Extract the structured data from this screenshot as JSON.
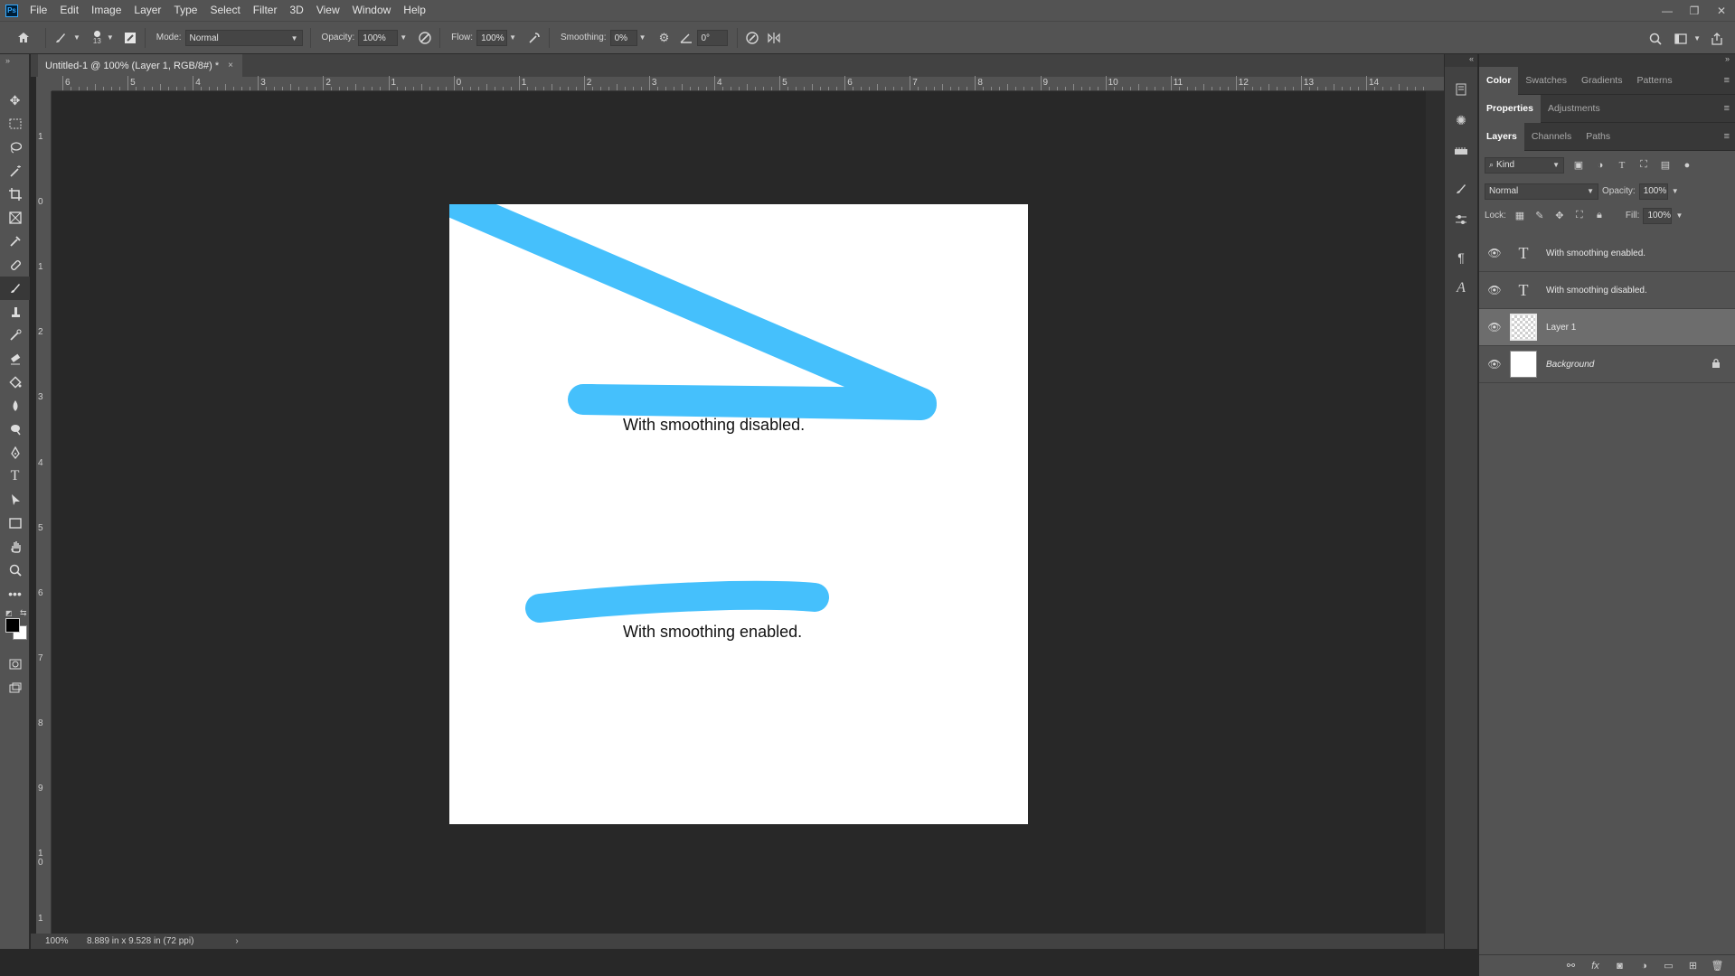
{
  "app": {
    "logo": "Ps"
  },
  "menu": [
    "File",
    "Edit",
    "Image",
    "Layer",
    "Type",
    "Select",
    "Filter",
    "3D",
    "View",
    "Window",
    "Help"
  ],
  "window_controls": {
    "minimize": "—",
    "restore": "❐",
    "close": "✕"
  },
  "options": {
    "brush_size": "13",
    "mode_label": "Mode:",
    "mode_value": "Normal",
    "opacity_label": "Opacity:",
    "opacity_value": "100%",
    "flow_label": "Flow:",
    "flow_value": "100%",
    "smoothing_label": "Smoothing:",
    "smoothing_value": "0%",
    "angle_value": "0°"
  },
  "document_tab": {
    "title": "Untitled-1 @ 100% (Layer 1, RGB/8#) *",
    "close": "×"
  },
  "rulers": {
    "horizontal": [
      "6",
      "5",
      "4",
      "3",
      "2",
      "1",
      "0",
      "1",
      "2",
      "3",
      "4",
      "5",
      "6",
      "7",
      "8",
      "9",
      "10",
      "11",
      "12",
      "13",
      "14"
    ],
    "vertical": [
      "1",
      "0",
      "1",
      "2",
      "3",
      "4",
      "5",
      "6",
      "7",
      "8",
      "9",
      "1\n0",
      "1"
    ]
  },
  "canvas": {
    "text_disabled": "With smoothing disabled.",
    "text_enabled": "With smoothing enabled.",
    "stroke_color": "#45c0fc"
  },
  "status": {
    "zoom": "100%",
    "doc_info": "8.889 in x 9.528 in (72 ppi)",
    "arrow": "›"
  },
  "panels": {
    "color_tabs": [
      "Color",
      "Swatches",
      "Gradients",
      "Patterns"
    ],
    "properties_tabs": [
      "Properties",
      "Adjustments"
    ],
    "layers_tabs": [
      "Layers",
      "Channels",
      "Paths"
    ],
    "filter_kind": "Kind",
    "blend_mode": "Normal",
    "opacity_label": "Opacity:",
    "opacity_value": "100%",
    "lock_label": "Lock:",
    "fill_label": "Fill:",
    "fill_value": "100%",
    "layers": [
      {
        "name": "With smoothing enabled.",
        "type": "text"
      },
      {
        "name": "With smoothing disabled.",
        "type": "text"
      },
      {
        "name": "Layer 1",
        "type": "pixel",
        "selected": true
      },
      {
        "name": "Background",
        "type": "background",
        "locked": true
      }
    ]
  }
}
